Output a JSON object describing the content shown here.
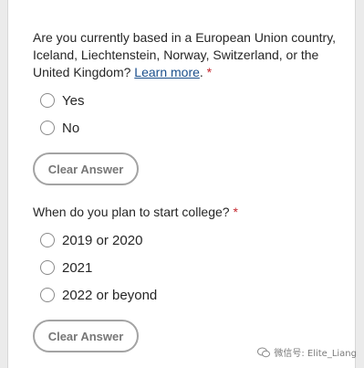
{
  "questions": [
    {
      "prompt": "Are you currently based in a European Union country, Iceland, Liechtenstein, Norway, Switzerland, or the United Kingdom?",
      "link_text": "Learn more",
      "link_suffix": ".",
      "required_marker": "*",
      "options": [
        "Yes",
        "No"
      ],
      "clear_label": "Clear Answer"
    },
    {
      "prompt": "When do you plan to start college?",
      "required_marker": "*",
      "options": [
        "2019 or 2020",
        "2021",
        "2022 or beyond"
      ],
      "clear_label": "Clear Answer"
    }
  ],
  "watermark": {
    "text": "微信号: Elite_Liang",
    "icon": "wechat-icon"
  }
}
